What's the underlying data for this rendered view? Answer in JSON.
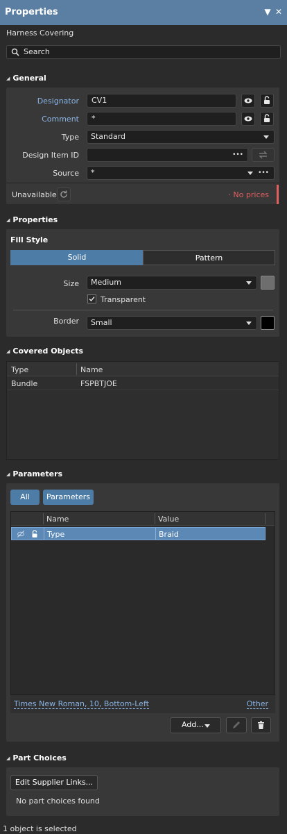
{
  "window": {
    "title": "Properties"
  },
  "object_type": "Harness Covering",
  "search": {
    "placeholder": "Search"
  },
  "general": {
    "header": "General",
    "designator_label": "Designator",
    "designator_value": "CV1",
    "comment_label": "Comment",
    "comment_value": "*",
    "type_label": "Type",
    "type_value": "Standard",
    "design_item_label": "Design Item ID",
    "design_item_value": "",
    "source_label": "Source",
    "source_value": "*",
    "availability": "Unavailable",
    "price_status": "· No prices",
    "ellipsis": "•••"
  },
  "properties": {
    "header": "Properties",
    "fill_style_label": "Fill Style",
    "seg_solid": "Solid",
    "seg_pattern": "Pattern",
    "selected_fill": "Solid",
    "size_label": "Size",
    "size_value": "Medium",
    "transparent_label": "Transparent",
    "transparent_checked": true,
    "border_label": "Border",
    "border_value": "Small",
    "size_color": "#6e6e6e",
    "border_color": "#000000"
  },
  "covered_objects": {
    "header": "Covered Objects",
    "columns": [
      "Type",
      "Name"
    ],
    "rows": [
      {
        "type": "Bundle",
        "name": "FSPBTJOE"
      }
    ]
  },
  "parameters": {
    "header": "Parameters",
    "filter_all": "All",
    "filter_parameters": "Parameters",
    "columns": [
      "Name",
      "Value"
    ],
    "rows": [
      {
        "name": "Type",
        "value": "Braid",
        "visible": false,
        "locked": true
      }
    ],
    "font_link": "Times New Roman, 10, Bottom-Left",
    "other_link": "Other",
    "add_button": "Add..."
  },
  "part_choices": {
    "header": "Part Choices",
    "edit_button": "Edit Supplier Links...",
    "empty_text": "No part choices found"
  },
  "status_bar": {
    "text": "1 object is selected"
  },
  "colors": {
    "accent": "#5a7fa3",
    "link": "#8ab4e6",
    "warning": "#e06060"
  }
}
